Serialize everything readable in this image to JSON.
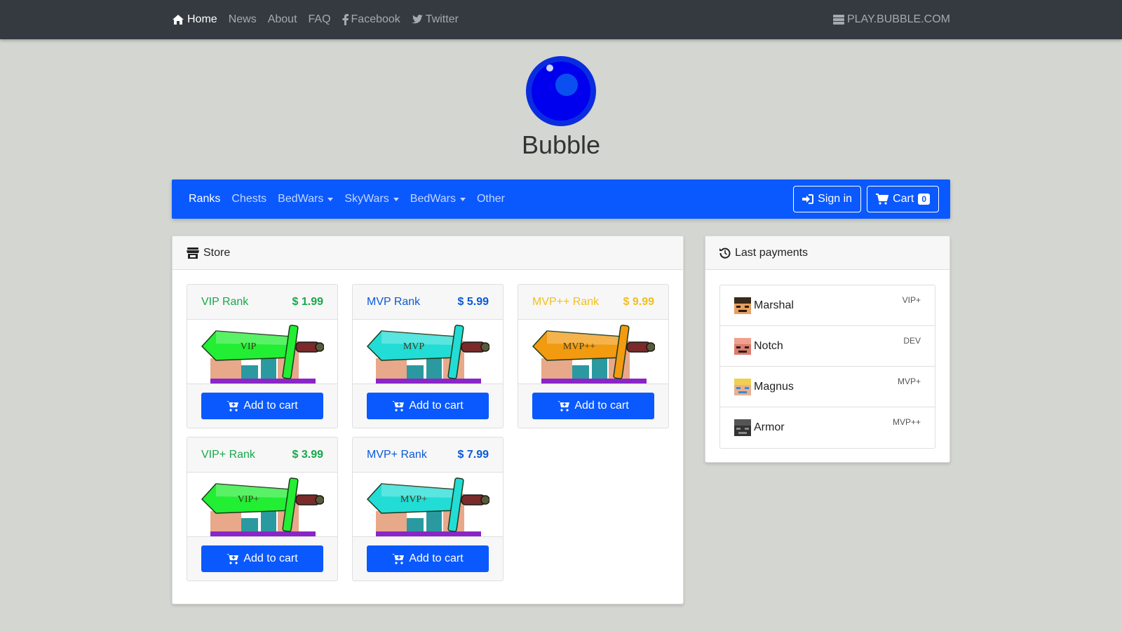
{
  "topnav": {
    "home": "Home",
    "news": "News",
    "about": "About",
    "faq": "FAQ",
    "facebook": "Facebook",
    "twitter": "Twitter",
    "server": "PLAY.BUBBLE.COM"
  },
  "brand": {
    "name": "Bubble"
  },
  "storenav": {
    "items": [
      "Ranks",
      "Chests",
      "BedWars",
      "SkyWars",
      "BedWars",
      "Other"
    ],
    "signin": "Sign in",
    "cart": "Cart",
    "cart_count": "0"
  },
  "store": {
    "title": "Store",
    "add_label": "Add to cart",
    "products": [
      {
        "name": "VIP Rank",
        "price": "$ 1.99",
        "color": "#17a84a",
        "sword_color": "#22ee33",
        "sword_text": "VIP"
      },
      {
        "name": "MVP Rank",
        "price": "$ 5.99",
        "color": "#0a59d8",
        "sword_color": "#22dcd6",
        "sword_text": "MVP"
      },
      {
        "name": "MVP++ Rank",
        "price": "$ 9.99",
        "color": "#f0c020",
        "sword_color": "#f29a10",
        "sword_text": "MVP++"
      },
      {
        "name": "VIP+ Rank",
        "price": "$ 3.99",
        "color": "#17a84a",
        "sword_color": "#22ee33",
        "sword_text": "VIP+"
      },
      {
        "name": "MVP+ Rank",
        "price": "$ 7.99",
        "color": "#0a59d8",
        "sword_color": "#22dcd6",
        "sword_text": "MVP+"
      }
    ]
  },
  "payments": {
    "title": "Last payments",
    "rows": [
      {
        "name": "Marshal",
        "rank": "VIP+"
      },
      {
        "name": "Notch",
        "rank": "DEV"
      },
      {
        "name": "Magnus",
        "rank": "MVP+"
      },
      {
        "name": "Armor",
        "rank": "MVP++"
      }
    ]
  }
}
